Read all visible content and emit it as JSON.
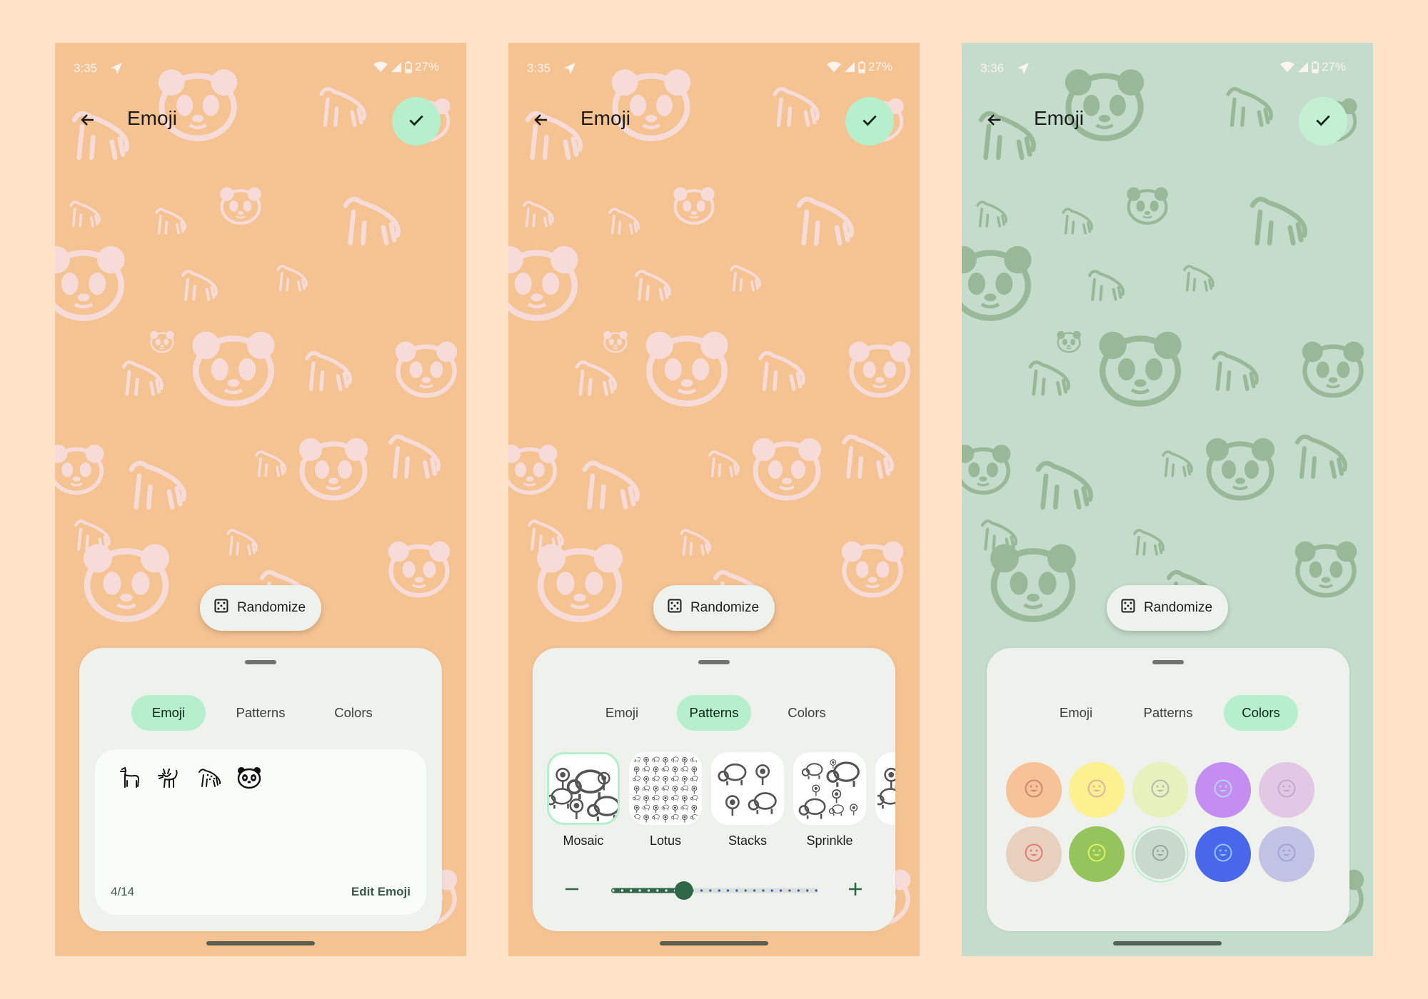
{
  "screens": [
    {
      "status": {
        "time": "3:35",
        "battery": "27%"
      },
      "title": "Emoji",
      "wallpaper": {
        "background": "#f5c392",
        "pattern_color": "#f7dbd9"
      },
      "randomize_label": "Randomize",
      "tabs": [
        {
          "label": "Emoji",
          "active": true
        },
        {
          "label": "Patterns",
          "active": false
        },
        {
          "label": "Colors",
          "active": false
        }
      ],
      "emoji_panel": {
        "selected_emoji": [
          "llama",
          "cat",
          "leopard",
          "panda"
        ],
        "count": "4/14",
        "edit_label": "Edit Emoji"
      }
    },
    {
      "status": {
        "time": "3:35",
        "battery": "27%"
      },
      "title": "Emoji",
      "wallpaper": {
        "background": "#f5c392",
        "pattern_color": "#f7dbd9"
      },
      "randomize_label": "Randomize",
      "tabs": [
        {
          "label": "Emoji",
          "active": false
        },
        {
          "label": "Patterns",
          "active": true
        },
        {
          "label": "Colors",
          "active": false
        }
      ],
      "patterns_panel": {
        "items": [
          {
            "label": "Mosaic",
            "selected": true
          },
          {
            "label": "Lotus",
            "selected": false
          },
          {
            "label": "Stacks",
            "selected": false
          },
          {
            "label": "Sprinkle",
            "selected": false
          },
          {
            "label": "",
            "selected": false
          }
        ],
        "density_slider": {
          "step": 8,
          "max_step": 23
        }
      }
    },
    {
      "status": {
        "time": "3:36",
        "battery": "27%"
      },
      "title": "Emoji",
      "wallpaper": {
        "background": "#c4dccb",
        "pattern_color": "#99b898"
      },
      "randomize_label": "Randomize",
      "tabs": [
        {
          "label": "Emoji",
          "active": false
        },
        {
          "label": "Patterns",
          "active": false
        },
        {
          "label": "Colors",
          "active": true
        }
      ],
      "colors_panel": {
        "rows": [
          [
            {
              "fill": "#f7c297",
              "face": "#c98a6e",
              "selected": false
            },
            {
              "fill": "#fdf08f",
              "face": "#e6b0a8",
              "selected": false
            },
            {
              "fill": "#e6f1be",
              "face": "#b6b9b2",
              "selected": false
            },
            {
              "fill": "#c48df2",
              "face": "#b7d5ef",
              "selected": false
            },
            {
              "fill": "#e3c8e6",
              "face": "#c7a8cf",
              "selected": false
            }
          ],
          [
            {
              "fill": "#e7d0bd",
              "face": "#e87a76",
              "selected": false
            },
            {
              "fill": "#96c45c",
              "face": "#ddf35e",
              "selected": false
            },
            {
              "fill": "#c7dacd",
              "face": "#8fa394",
              "selected": true
            },
            {
              "fill": "#4967ea",
              "face": "#8ec4f7",
              "selected": false
            },
            {
              "fill": "#c2c2e6",
              "face": "#a3a4d6",
              "selected": false
            }
          ]
        ]
      }
    }
  ],
  "accent": {
    "confirm_bg": "#b5efcb",
    "tab_active_bg": "#b5efcb",
    "slider_active": "#2f6748",
    "slider_inactive_dot": "#3c4fc5"
  }
}
